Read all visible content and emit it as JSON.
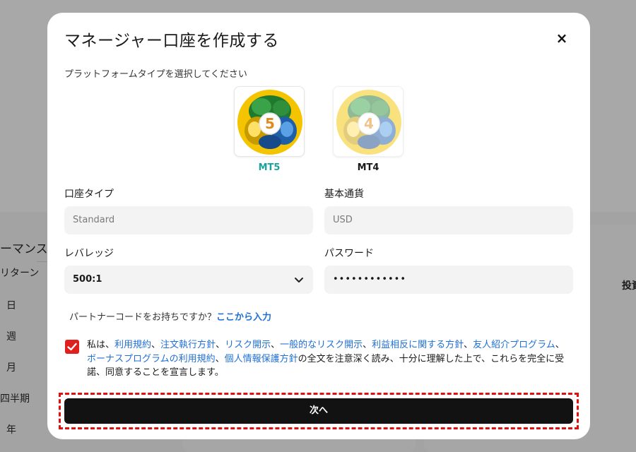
{
  "modal": {
    "title": "マネージャー口座を作成する",
    "close_label": "×",
    "platform_label": "プラットフォームタイプを選択してください",
    "platforms": [
      {
        "name": "MT5",
        "badge": "5",
        "selected": true
      },
      {
        "name": "MT4",
        "badge": "4",
        "selected": false
      }
    ],
    "fields": {
      "account_type": {
        "label": "口座タイプ",
        "placeholder": "Standard"
      },
      "base_currency": {
        "label": "基本通貨",
        "placeholder": "USD"
      },
      "leverage": {
        "label": "レバレッジ",
        "value": "500:1"
      },
      "password": {
        "label": "パスワード",
        "value": "••••••••••••"
      }
    },
    "partner": {
      "text": "パートナーコードをお持ちですか？",
      "link": "ここから入力"
    },
    "agreement": {
      "checked": true,
      "prefix": "私は、",
      "links": [
        "利用規約",
        "注文執行方針",
        "リスク開示",
        "一般的なリスク開示",
        "利益相反に関する方針",
        "友人紹介プログラム",
        "ボーナスプログラムの利用規約",
        "個人情報保護方針"
      ],
      "separator": "、",
      "suffix": "の全文を注意深く読み、十分に理解した上で、これらを完全に受諾、同意することを宣言します。"
    },
    "next_label": "次へ"
  },
  "background": {
    "left_items": [
      "ーマンス",
      "リターン",
      "日",
      "週",
      "月",
      "四半期",
      "年"
    ],
    "right_label": "投資"
  },
  "colors": {
    "accent_mt5": "#1aa39a",
    "link": "#1f6fd6",
    "checkbox": "#e0201f",
    "button": "#121212",
    "highlight": "#e01010"
  }
}
